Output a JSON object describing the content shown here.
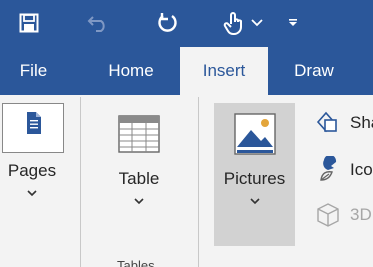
{
  "quick_access": {
    "items": [
      {
        "name": "save",
        "icon": "save-icon"
      },
      {
        "name": "undo",
        "icon": "undo-icon",
        "disabled": true
      },
      {
        "name": "redo",
        "icon": "redo-icon"
      },
      {
        "name": "touch-mode",
        "icon": "touch-icon"
      },
      {
        "name": "customize",
        "icon": "customize-dropdown-icon"
      }
    ]
  },
  "tabs": [
    {
      "label": "File"
    },
    {
      "label": "Home"
    },
    {
      "label": "Insert",
      "active": true
    },
    {
      "label": "Draw"
    }
  ],
  "ribbon": {
    "pages": {
      "label": "Pages",
      "icon": "page-icon"
    },
    "table": {
      "label": "Table",
      "icon": "table-icon"
    },
    "tables_group_label": "Tables",
    "pictures": {
      "label": "Pictures",
      "icon": "picture-icon"
    },
    "shapes": {
      "label": "Sha",
      "icon": "shapes-icon"
    },
    "icons": {
      "label": "Ico",
      "icon": "icons-icon"
    },
    "models3d": {
      "label": "3D",
      "icon": "3d-models-icon",
      "disabled": true
    }
  },
  "colors": {
    "brand": "#2b579a",
    "ribbon_bg": "#f3f3f3",
    "pressed_bg": "#d2d2d2"
  }
}
